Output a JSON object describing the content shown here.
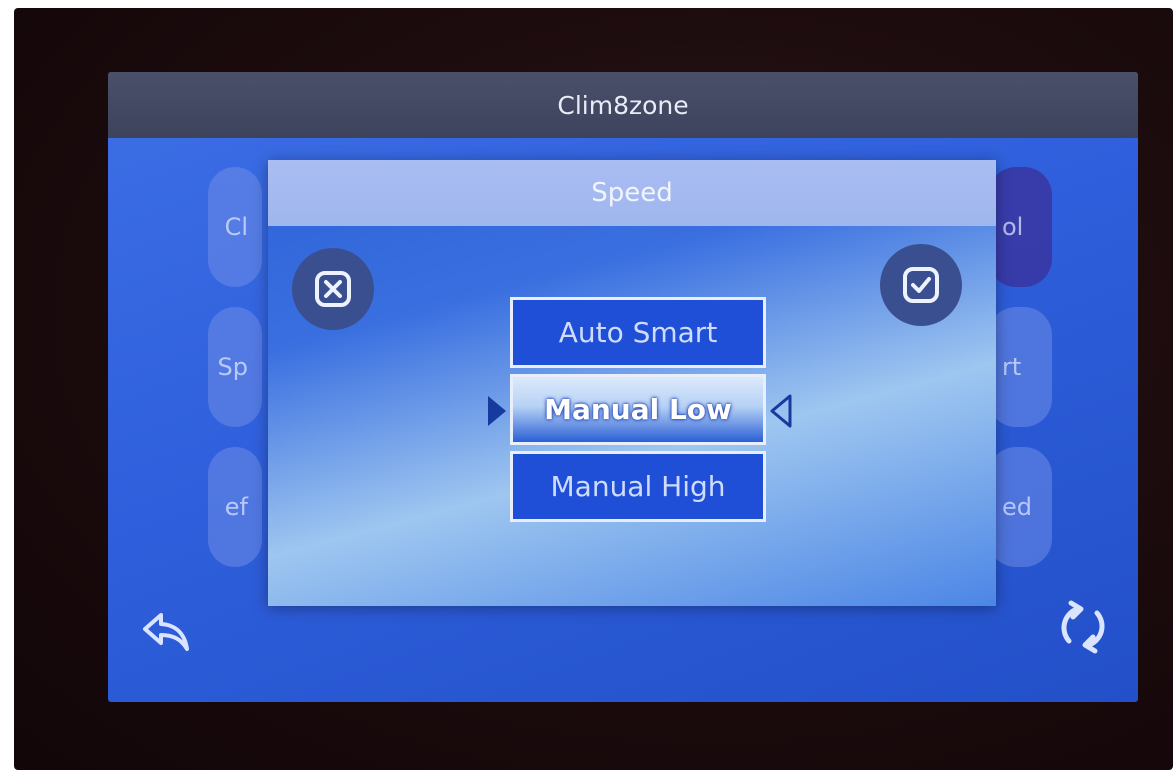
{
  "app": {
    "title": "Clim8zone"
  },
  "background_tiles": {
    "left": [
      "Cl",
      "Sp",
      "ef"
    ],
    "right": [
      "ol",
      "rt",
      "ed"
    ]
  },
  "dialog": {
    "title": "Speed",
    "cancel_icon": "close-box-icon",
    "confirm_icon": "checkbox-checked-icon",
    "options": [
      {
        "label": "Auto Smart",
        "selected": false
      },
      {
        "label": "Manual Low",
        "selected": true
      },
      {
        "label": "Manual High",
        "selected": false
      }
    ]
  },
  "footer": {
    "back_icon": "back-arrow-icon",
    "refresh_icon": "refresh-icon"
  },
  "colors": {
    "screen_blue": "#2f5fdc",
    "title_bar": "#434860",
    "dialog_header": "#a3b9ef",
    "option_bg": "#1f4fd6",
    "round_button": "#3a4f8f"
  }
}
